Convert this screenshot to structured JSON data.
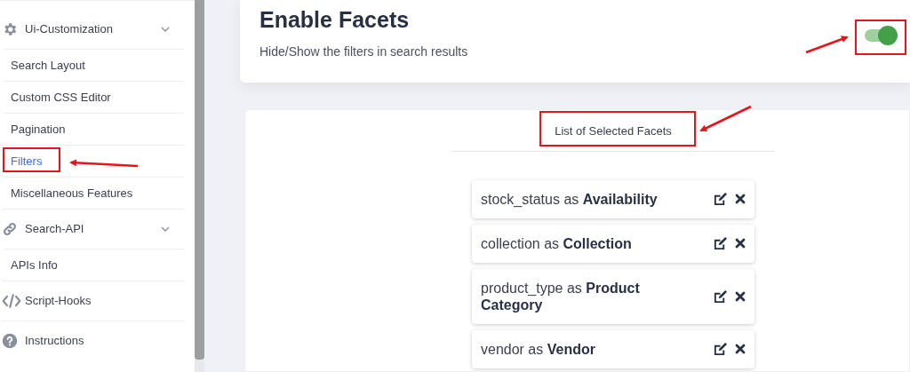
{
  "sidebar": {
    "sections": [
      {
        "label": "Ui-Customization",
        "children": [
          {
            "label": "Search Layout",
            "selected": false
          },
          {
            "label": "Custom CSS Editor",
            "selected": false
          },
          {
            "label": "Pagination",
            "selected": false
          },
          {
            "label": "Filters",
            "selected": true
          },
          {
            "label": "Miscellaneous Features",
            "selected": false
          }
        ]
      },
      {
        "label": "Search-API",
        "children": [
          {
            "label": "APIs Info",
            "selected": false
          }
        ]
      },
      {
        "label": "Script-Hooks"
      },
      {
        "label": "Instructions"
      }
    ]
  },
  "settings_card": {
    "title": "Enable Facets",
    "description": "Hide/Show the filters in search results",
    "toggle": {
      "on": true
    }
  },
  "facets_panel": {
    "title": "List of Selected Facets",
    "facets": [
      {
        "text": "stock_status as **Availability**"
      },
      {
        "text": "collection as **Collection**"
      },
      {
        "text": "product_type as **Product Category**"
      },
      {
        "text": "vendor as **Vendor**"
      }
    ]
  }
}
